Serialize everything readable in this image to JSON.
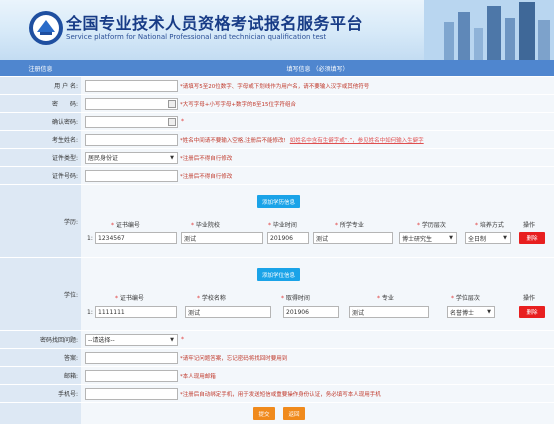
{
  "header": {
    "title_cn": "全国专业技术人员资格考试报名服务平台",
    "title_en": "Service platform for National Professional and technician qualification test"
  },
  "section": {
    "left": "注册信息",
    "right": "填写信息 （必须填写）"
  },
  "fields": {
    "username": {
      "label": "用 户 名:",
      "value": "",
      "hint": "*请填写5至20位数字、字母或下划线作为用户名，请不要输入汉字或其他符号"
    },
    "password": {
      "label": "密　　码:",
      "value": "",
      "hint": "*大写字母+小写字母+数字的8至15位字符组合"
    },
    "confirm_password": {
      "label": "确认密码:",
      "value": "",
      "hint": "*"
    },
    "name": {
      "label": "考生姓名:",
      "value": "",
      "hint": "*姓名中间请不要输入空格,注册后不能修改!",
      "link": "如姓名中含有生僻字或“.”，参见姓名中如何输入生僻字"
    },
    "id_type": {
      "label": "证件类型:",
      "value": "居民身份证",
      "hint": "*注册后不得自行修改"
    },
    "id_number": {
      "label": "证件号码:",
      "value": "",
      "hint": "*注册后不得自行修改"
    },
    "security_question": {
      "label": "密码找回问题:",
      "value": "--请选择--",
      "hint": "*"
    },
    "answer": {
      "label": "答案:",
      "value": "",
      "hint": "*请牢记问题答案，忘记密码将找回时要用到"
    },
    "email": {
      "label": "邮箱:",
      "value": "",
      "hint": "*本人现用邮箱"
    },
    "phone": {
      "label": "手机号:",
      "value": "",
      "hint": "*注册后自动绑定手机，用于发送短信或重要操作身份认证，务必填写本人现用手机"
    }
  },
  "education": {
    "label": "学历:",
    "add_button": "添加学历信息",
    "columns": [
      "证书编号",
      "毕业院校",
      "毕业时间",
      "所学专业",
      "学历层次",
      "培养方式",
      "操作"
    ],
    "required_marks": [
      "*",
      "*",
      "*",
      "*",
      "*",
      "*",
      ""
    ],
    "row": {
      "index": "1:",
      "cert_no": "1234567",
      "school": "测试",
      "grad_time": "201906",
      "major": "测试",
      "level": "博士研究生",
      "mode": "全日制",
      "delete": "删除"
    }
  },
  "degree": {
    "label": "学位:",
    "add_button": "添加学位信息",
    "columns": [
      "证书编号",
      "学校名称",
      "取得时间",
      "专业",
      "学位层次",
      "操作"
    ],
    "required_marks": [
      "*",
      "*",
      "*",
      "*",
      "*",
      ""
    ],
    "row": {
      "index": "1:",
      "cert_no": "1111111",
      "school": "测试",
      "obtain_time": "201906",
      "major": "测试",
      "level": "名誉博士",
      "delete": "删除"
    }
  },
  "buttons": {
    "submit": "提交",
    "back": "返回"
  },
  "colors": {
    "header_bar": "#4f86cf",
    "label_bg": "#dde8f4",
    "add_button": "#1aa3e8",
    "delete_button": "#e81f1f",
    "action_button": "#f08a1c",
    "hint_red": "#c0392b"
  }
}
